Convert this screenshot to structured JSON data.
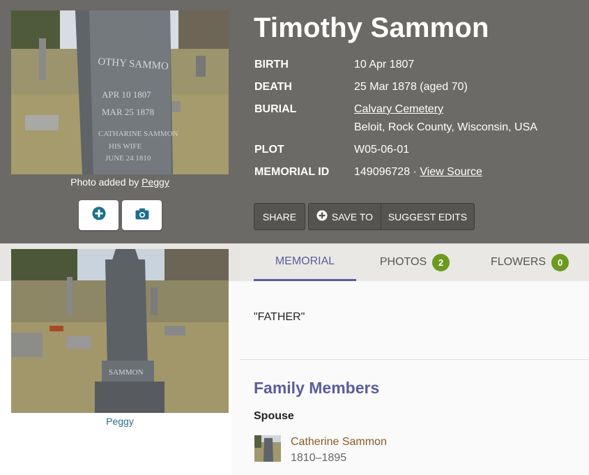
{
  "memorial": {
    "name": "Timothy Sammon",
    "facts": [
      {
        "label": "BIRTH",
        "value": "10 Apr 1807"
      },
      {
        "label": "DEATH",
        "value": "25 Mar 1878 (aged 70)"
      },
      {
        "label": "BURIAL",
        "value": "Calvary Cemetery",
        "location": "Beloit, Rock County, Wisconsin, USA"
      },
      {
        "label": "PLOT",
        "value": "W05-06-01"
      },
      {
        "label": "MEMORIAL ID",
        "value": "149096728 ·",
        "link": "View Source"
      }
    ]
  },
  "photo": {
    "caption_prefix": "Photo added by",
    "caption_user": "Peggy",
    "second_caption": "Peggy"
  },
  "actions": {
    "share": "SHARE",
    "save_to": "SAVE TO",
    "suggest_edits": "SUGGEST EDITS"
  },
  "tabs": [
    {
      "label": "MEMORIAL"
    },
    {
      "label": "PHOTOS",
      "count": "2"
    },
    {
      "label": "FLOWERS",
      "count": "0"
    }
  ],
  "inscription": "\"FATHER\"",
  "family": {
    "heading": "Family Members",
    "spouse_label": "Spouse",
    "spouse": {
      "name": "Catherine Sammon",
      "dates": "1810–1895"
    }
  },
  "colors": {
    "header_bg": "#6b6a66",
    "accent": "#5b5e99",
    "badge": "#6c9a1f",
    "link_brown": "#8a5a25"
  },
  "icons": [
    "add-photo-icon",
    "camera-icon",
    "plus-circle-icon"
  ]
}
